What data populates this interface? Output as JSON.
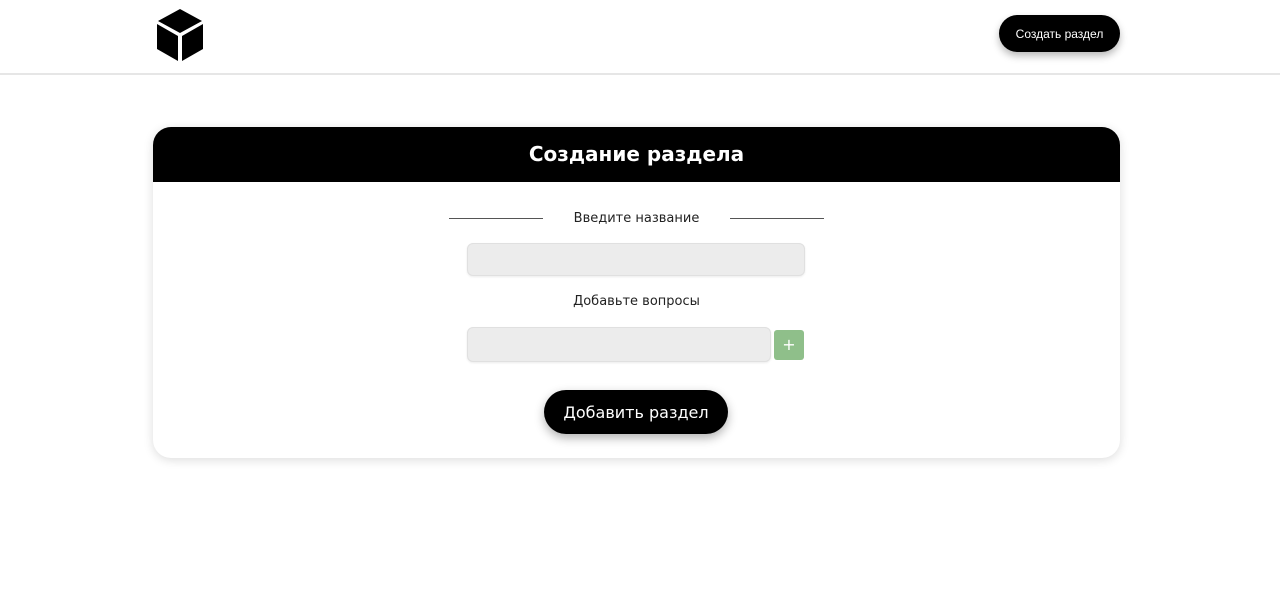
{
  "header": {
    "logo_icon": "cube-icon",
    "create_section_label": "Создать раздел"
  },
  "form": {
    "title": "Создание раздела",
    "name_label": "Введите название",
    "name_value": "",
    "questions_label": "Добавьте вопросы",
    "question_value": "",
    "add_question_label": "+",
    "submit_label": "Добавить раздел"
  },
  "colors": {
    "primary": "#000000",
    "background": "#ffffff",
    "input_bg": "#ececec",
    "add_button": "#8fbf8a"
  }
}
